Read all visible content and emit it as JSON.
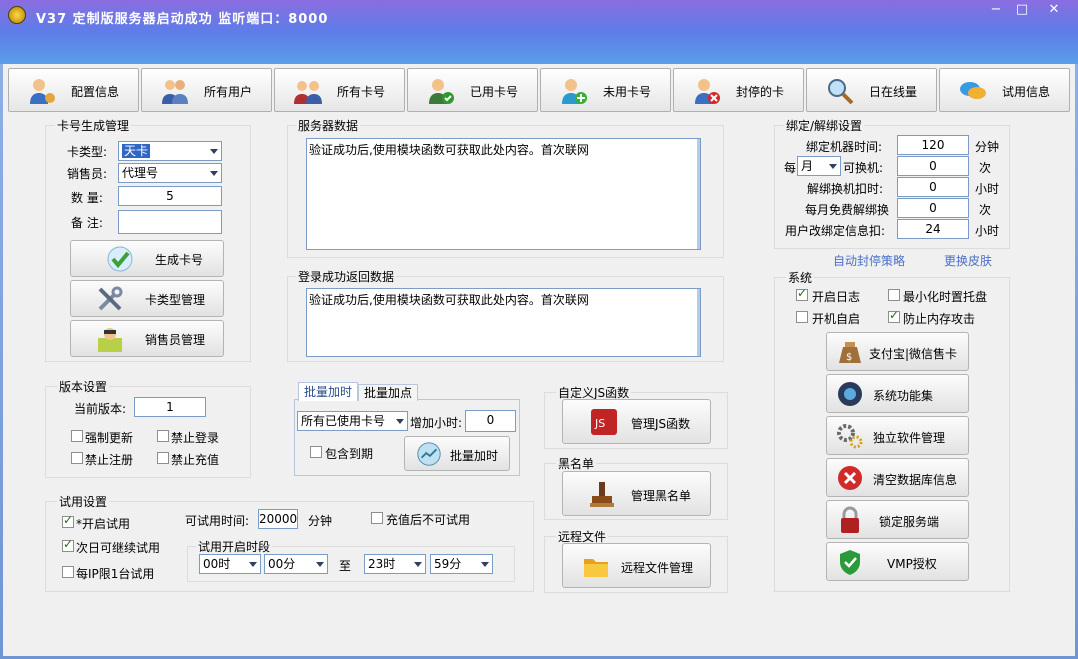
{
  "title": "V37 定制版服务器启动成功   监听端口：8000",
  "window_buttons": {
    "min": "−",
    "max": "□",
    "close": "✕"
  },
  "toolbar": [
    {
      "label": "配置信息",
      "icon": "user-config-icon"
    },
    {
      "label": "所有用户",
      "icon": "users-icon"
    },
    {
      "label": "所有卡号",
      "icon": "cards-icon"
    },
    {
      "label": "已用卡号",
      "icon": "used-card-icon"
    },
    {
      "label": "未用卡号",
      "icon": "unused-card-icon"
    },
    {
      "label": "封停的卡",
      "icon": "banned-card-icon"
    },
    {
      "label": "日在线量",
      "icon": "magnifier-icon"
    },
    {
      "label": "试用信息",
      "icon": "chat-icon"
    }
  ],
  "card_gen": {
    "title": "卡号生成管理",
    "type_label": "卡类型:",
    "type_value": "天卡",
    "seller_label": "销售员:",
    "seller_value": "代理号",
    "qty_label": "数 量:",
    "qty_value": "5",
    "note_label": "备 注:",
    "note_value": "",
    "gen_btn": "生成卡号",
    "type_btn": "卡类型管理",
    "seller_btn": "销售员管理"
  },
  "server_data": {
    "title": "服务器数据",
    "text": "验证成功后,使用模块函数可获取此处内容。首次联网"
  },
  "login_data": {
    "title": "登录成功返回数据",
    "text": "验证成功后,使用模块函数可获取此处内容。首次联网"
  },
  "bind": {
    "title": "绑定/解绑设置",
    "machine_time_label": "绑定机器时间:",
    "machine_time_value": "120",
    "machine_time_unit": "分钟",
    "per_label": "每",
    "per_value": "月",
    "change_label": "可换机:",
    "change_value": "0",
    "change_unit": "次",
    "unbind_deduct_label": "解绑换机扣时:",
    "unbind_deduct_value": "0",
    "unbind_deduct_unit": "小时",
    "free_unbind_label": "每月免费解绑换",
    "free_unbind_value": "0",
    "free_unbind_unit": "次",
    "user_change_label": "用户改绑定信息扣:",
    "user_change_value": "24",
    "user_change_unit": "小时"
  },
  "links": {
    "auto_ban": "自动封停策略",
    "skin": "更换皮肤"
  },
  "system": {
    "title": "系统",
    "log": "开启日志",
    "tray": "最小化时置托盘",
    "autostart": "开机自启",
    "memory": "防止内存攻击",
    "buttons": [
      "支付宝|微信售卡",
      "系统功能集",
      "独立软件管理",
      "清空数据库信息",
      "锁定服务端",
      "VMP授权"
    ]
  },
  "version": {
    "title": "版本设置",
    "current_label": "当前版本:",
    "current_value": "1",
    "force_update": "强制更新",
    "forbid_login": "禁止登录",
    "forbid_register": "禁止注册",
    "forbid_recharge": "禁止充值"
  },
  "batch": {
    "tab1": "批量加时",
    "tab2": "批量加点",
    "scope_value": "所有已使用卡号",
    "hours_label": "增加小时:",
    "hours_value": "0",
    "expired_label": "包含到期",
    "btn": "批量加时"
  },
  "js": {
    "title": "自定义JS函数",
    "btn": "管理JS函数"
  },
  "blacklist": {
    "title": "黑名单",
    "btn": "管理黑名单"
  },
  "remote": {
    "title": "远程文件",
    "btn": "远程文件管理"
  },
  "trial": {
    "title": "试用设置",
    "enable": "*开启试用",
    "next_day": "次日可继续试用",
    "per_ip": "每IP限1台试用",
    "time_label": "可试用时间:",
    "time_value": "20000",
    "time_unit": "分钟",
    "no_trial_after_recharge": "充值后不可试用",
    "period_label": "试用开启时段",
    "from_hour": "00时",
    "from_min": "00分",
    "to_label": "至",
    "to_hour": "23时",
    "to_min": "59分"
  },
  "colors": {
    "title_grad_start": "#8a6de0",
    "title_grad_end": "#5a9ee8",
    "client_bg": "#f0f0f0",
    "link": "#4a70c8",
    "select_highlight": "#3165c4"
  }
}
